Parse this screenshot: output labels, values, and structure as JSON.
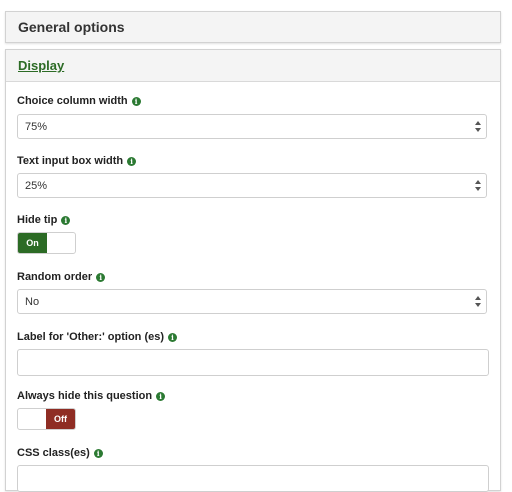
{
  "general_panel": {
    "title": "General options"
  },
  "display_panel": {
    "title": "Display"
  },
  "fields": {
    "choice_column_width": {
      "label": "Choice column width",
      "value": "75%"
    },
    "text_input_box_width": {
      "label": "Text input box width",
      "value": "25%"
    },
    "hide_tip": {
      "label": "Hide tip",
      "state": "On"
    },
    "random_order": {
      "label": "Random order",
      "value": "No"
    },
    "other_label": {
      "label": "Label for 'Other:' option (es)",
      "value": ""
    },
    "always_hide": {
      "label": "Always hide this question",
      "state": "Off"
    },
    "css_classes": {
      "label": "CSS class(es)"
    }
  },
  "icons": {
    "info": "info-icon",
    "select_arrows": "up-down-arrows-icon"
  },
  "colors": {
    "accent_green": "#2c6b25",
    "off_red": "#8f2d24",
    "info_green": "#2c7a33"
  }
}
